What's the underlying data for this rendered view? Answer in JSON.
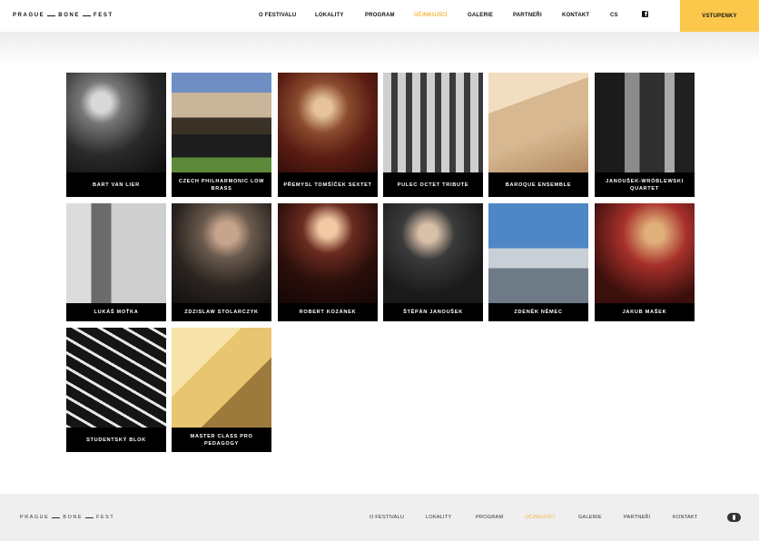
{
  "brand": {
    "word1": "PRAGUE",
    "word2": "BONE",
    "word3": "FEST"
  },
  "nav": [
    {
      "label": "O FESTIVALU"
    },
    {
      "label": "LOKALITY"
    },
    {
      "label": "PROGRAM"
    },
    {
      "label": "ÚČINKUJÍCÍ",
      "active": true
    },
    {
      "label": "GALERIE"
    },
    {
      "label": "PARTNEŘI"
    },
    {
      "label": "KONTAKT"
    },
    {
      "label": "CS"
    }
  ],
  "social": {
    "icon": "facebook-icon"
  },
  "tickets": {
    "label": "VSTUPENKY",
    "color": "#fcc84b"
  },
  "accent_color": "#f3b23a",
  "performers": [
    {
      "name": "BART VAN LIER"
    },
    {
      "name": "CZECH PHILHARMONIC LOW BRASS"
    },
    {
      "name": "PŘEMYSL TOMŠÍČEK SEXTET"
    },
    {
      "name": "PULEC OCTET TRIBUTE"
    },
    {
      "name": "BAROQUE ENSEMBLE"
    },
    {
      "name": "JANOUŠEK-WRÓBLEWSKI QUARTET"
    },
    {
      "name": "LUKÁŠ MOŤKA"
    },
    {
      "name": "ZDZISLAW STOLARCZYK"
    },
    {
      "name": "ROBERT KOZÁNEK"
    },
    {
      "name": "ŠTĚPÁN JANOUŠEK"
    },
    {
      "name": "ZDENĚK NĚMEC"
    },
    {
      "name": "JAKUB MAŠEK"
    },
    {
      "name": "STUDENTSKÝ BLOK"
    },
    {
      "name": "MASTER CLASS PRO PEDAGOGY"
    }
  ],
  "footer": {
    "brand": {
      "word1": "PRAGUE",
      "word2": "BONE",
      "word3": "FEST"
    },
    "nav": [
      {
        "label": "O FESTIVALU"
      },
      {
        "label": "LOKALITY"
      },
      {
        "label": "PROGRAM"
      },
      {
        "label": "ÚČINKUJÍCÍ",
        "active": true
      },
      {
        "label": "GALERIE"
      },
      {
        "label": "PARTNEŘI"
      },
      {
        "label": "KONTAKT"
      }
    ],
    "icon": "festival-logo-icon"
  }
}
